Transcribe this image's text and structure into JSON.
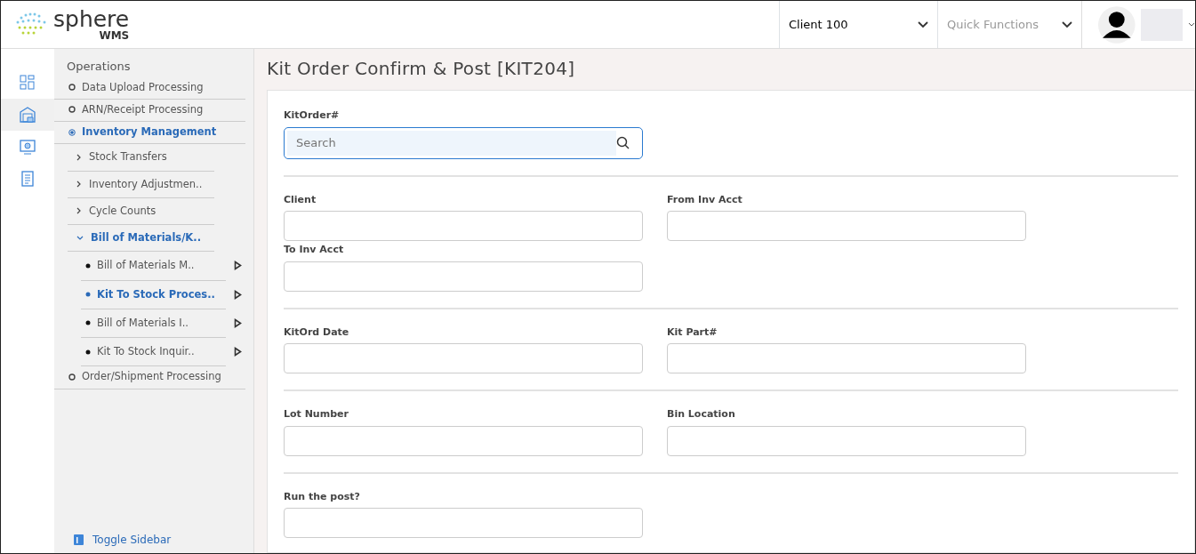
{
  "header": {
    "logo_name": "sphere",
    "logo_sub": "WMS",
    "client_select": {
      "value": "Client 100"
    },
    "quick_functions": {
      "placeholder": "Quick Functions"
    }
  },
  "rail": [
    {
      "selected": false
    },
    {
      "selected": true
    },
    {
      "selected": false
    },
    {
      "selected": false
    }
  ],
  "sidebar": {
    "title": "Operations",
    "items": [
      {
        "label": "Data Upload Processing",
        "selected": false
      },
      {
        "label": "ARN/Receipt Processing",
        "selected": false
      },
      {
        "label": "Inventory Management",
        "selected": true,
        "children": [
          {
            "label": "Stock Transfers",
            "expanded": false,
            "selected": false
          },
          {
            "label": "Inventory Adjustmen..",
            "expanded": false,
            "selected": false
          },
          {
            "label": "Cycle Counts",
            "expanded": false,
            "selected": false
          },
          {
            "label": "Bill of Materials/K..",
            "expanded": true,
            "selected": true,
            "children": [
              {
                "label": "Bill of Materials M..",
                "selected": false
              },
              {
                "label": "Kit To Stock Proces..",
                "selected": true
              },
              {
                "label": "Bill of Materials I..",
                "selected": false
              },
              {
                "label": "Kit To Stock Inquir..",
                "selected": false
              }
            ]
          }
        ]
      },
      {
        "label": "Order/Shipment Processing",
        "selected": false
      }
    ],
    "toggle": "Toggle Sidebar"
  },
  "page_title": "Kit Order Confirm & Post [KIT204]",
  "search_field": {
    "label": "KitOrder#",
    "placeholder": "Search"
  },
  "sections": [
    [
      {
        "label": "Client"
      },
      {
        "label": "From Inv Acct"
      },
      {
        "label": "To Inv Acct"
      }
    ],
    [
      {
        "label": "KitOrd Date"
      },
      {
        "label": "Kit Part#"
      }
    ],
    [
      {
        "label": "Lot Number"
      },
      {
        "label": "Bin Location"
      }
    ],
    [
      {
        "label": "Run the post?"
      }
    ]
  ]
}
